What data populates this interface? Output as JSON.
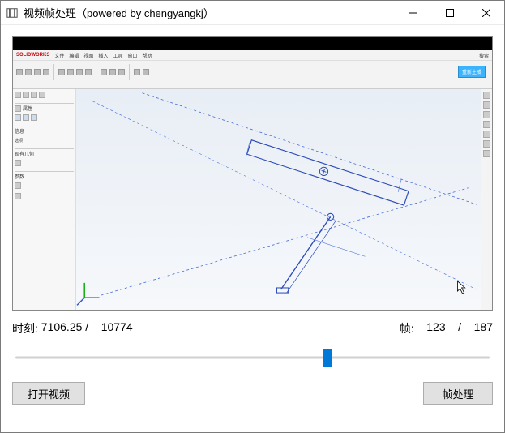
{
  "titlebar": {
    "title": "视频帧处理（powered by chengyangkj）"
  },
  "status": {
    "time_label": "时刻: ",
    "time_value": "7106.25",
    "time_sep": " /    ",
    "time_total": "10774",
    "frame_label": "帧:    ",
    "frame_value": "123",
    "frame_sep": "    /    ",
    "frame_total": "187"
  },
  "slider": {
    "min": 0,
    "max": 187,
    "value": 123
  },
  "buttons": {
    "open_video": "打开视频",
    "process_frame": "帧处理"
  },
  "inner_app": {
    "brand": "SOLIDWORKS",
    "rebuild_label": "重新生成"
  }
}
